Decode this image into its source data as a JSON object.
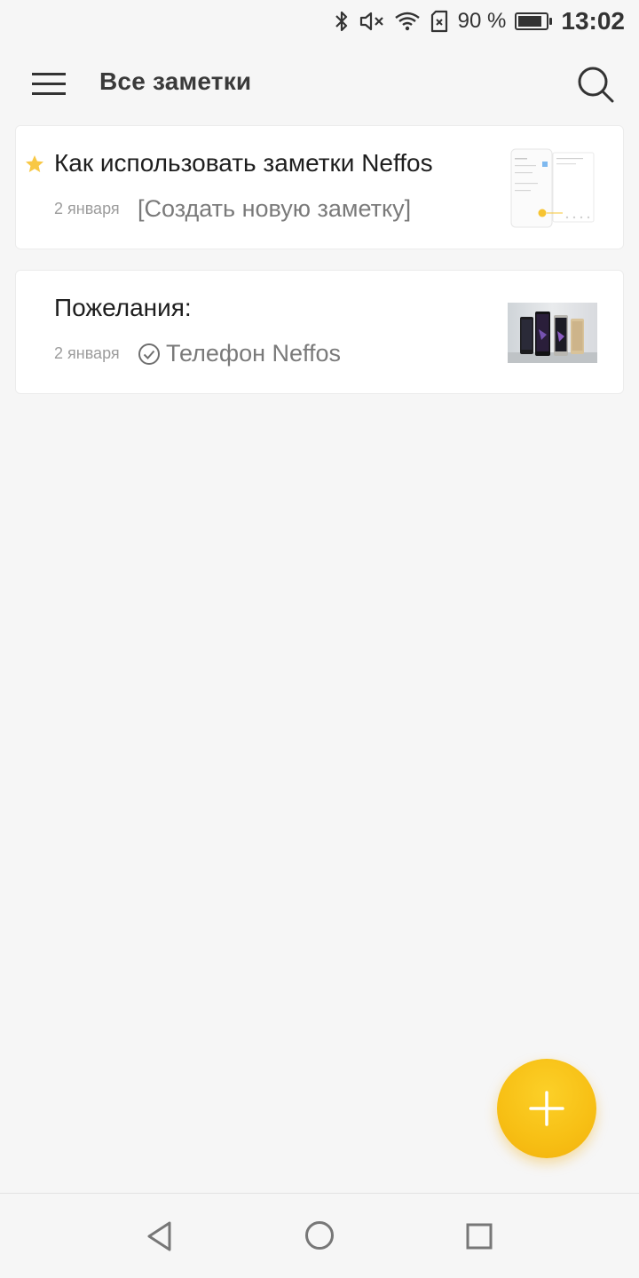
{
  "status_bar": {
    "battery_percent_label": "90 %",
    "battery_level": 0.9,
    "time": "13:02",
    "icons": [
      "bluetooth-icon",
      "mute-icon",
      "wifi-icon",
      "no-sim-icon",
      "battery-icon"
    ]
  },
  "app_bar": {
    "title": "Все заметки",
    "menu_icon": "hamburger-menu-icon",
    "search_icon": "search-icon"
  },
  "notes": [
    {
      "title": "Как использовать заметки Neffos",
      "date": "2 января",
      "snippet": "[Создать новую заметку]",
      "starred": true,
      "thumbnail": "app-screenshot-thumbnail"
    },
    {
      "title": "Пожелания:",
      "date": "2 января",
      "snippet": "Телефон Neffos",
      "checklist": true,
      "thumbnail": "phones-photo-thumbnail"
    }
  ],
  "fab": {
    "icon": "plus-icon"
  },
  "nav_bar": {
    "icons": [
      "back-icon",
      "home-icon",
      "recent-apps-icon"
    ]
  },
  "colors": {
    "accent": "#f7bf14",
    "star": "#f8c845",
    "background": "#f6f6f6",
    "card": "#ffffff"
  }
}
